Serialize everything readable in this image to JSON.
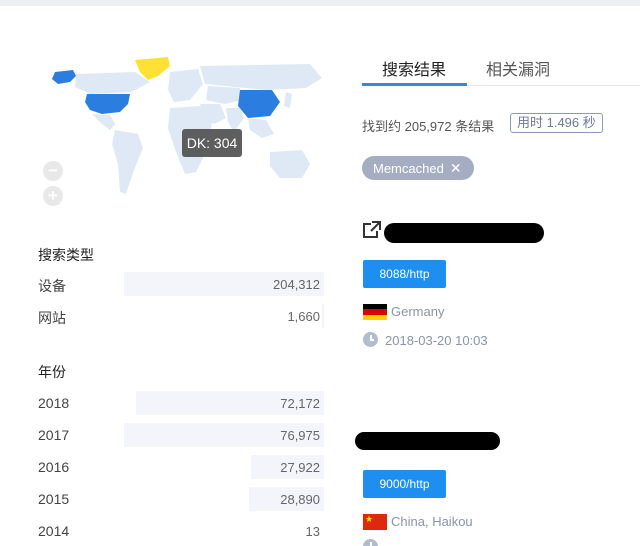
{
  "map": {
    "tooltip": "DK: 304",
    "zoom_out_label": "−",
    "zoom_in_label": "+",
    "colors": {
      "land": "#dfe9f5",
      "highlight": "#2b7ee0",
      "top": "#ffe135"
    }
  },
  "stats": {
    "search_type": {
      "title": "搜索类型",
      "rows": [
        {
          "label": "设备",
          "value": "204,312",
          "count": 204312
        },
        {
          "label": "网站",
          "value": "1,660",
          "count": 1660
        }
      ]
    },
    "year": {
      "title": "年份",
      "rows": [
        {
          "label": "2018",
          "value": "72,172",
          "count": 72172
        },
        {
          "label": "2017",
          "value": "76,975",
          "count": 76975
        },
        {
          "label": "2016",
          "value": "27,922",
          "count": 27922
        },
        {
          "label": "2015",
          "value": "28,890",
          "count": 28890
        },
        {
          "label": "2014",
          "value": "13",
          "count": 13
        }
      ]
    }
  },
  "tabs": [
    {
      "label": "搜索结果",
      "active": true
    },
    {
      "label": "相关漏洞",
      "active": false
    }
  ],
  "summary": {
    "count_text": "找到约 205,972 条结果",
    "elapsed_text": "用时 1.496 秒"
  },
  "filter": {
    "label": "Memcached",
    "remove_icon": "close-icon"
  },
  "results": [
    {
      "port": "8088/http",
      "country": "Germany",
      "flag": "germany-flag",
      "time": "2018-03-20 10:03"
    },
    {
      "port": "9000/http",
      "country": "China, Haikou",
      "flag": "china-flag"
    }
  ]
}
